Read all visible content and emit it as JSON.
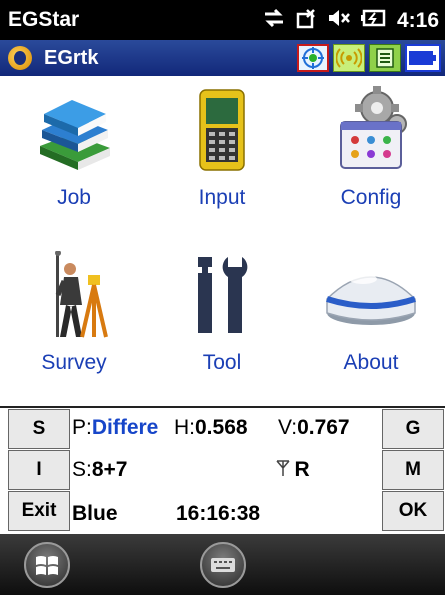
{
  "status_bar": {
    "title": "EGStar",
    "time": "4:16",
    "icons": [
      "connectivity-icon",
      "no-signal-icon",
      "volume-muted-icon",
      "battery-charging-icon"
    ]
  },
  "app_bar": {
    "title": "EGrtk",
    "icons": [
      "gps-target-icon",
      "radio-signal-icon",
      "data-log-icon",
      "battery-icon"
    ]
  },
  "menu": [
    {
      "label": "Job",
      "icon": "books-icon"
    },
    {
      "label": "Input",
      "icon": "handheld-device-icon"
    },
    {
      "label": "Config",
      "icon": "gears-icon"
    },
    {
      "label": "Survey",
      "icon": "surveyor-tripod-icon"
    },
    {
      "label": "Tool",
      "icon": "wrench-icon"
    },
    {
      "label": "About",
      "icon": "gnss-receiver-icon"
    }
  ],
  "panel": {
    "buttons": {
      "s": "S",
      "i": "I",
      "exit": "Exit",
      "g": "G",
      "m": "M",
      "ok": "OK"
    },
    "position_prefix": "P:",
    "position_mode": "Differe",
    "h_prefix": "H:",
    "h_value": "0.568",
    "v_prefix": "V:",
    "v_value": "0.767",
    "sat_prefix": "S:",
    "sat_value": "8+7",
    "radio_status": "R",
    "link": "Blue",
    "clock": "16:16:38"
  },
  "taskbar": {
    "icons": [
      "windows-start-icon",
      "keyboard-icon"
    ]
  },
  "colors": {
    "app_bar": "#1d3a8f",
    "label_blue": "#1b3fb5",
    "gps_highlight": "#c61b1b"
  }
}
